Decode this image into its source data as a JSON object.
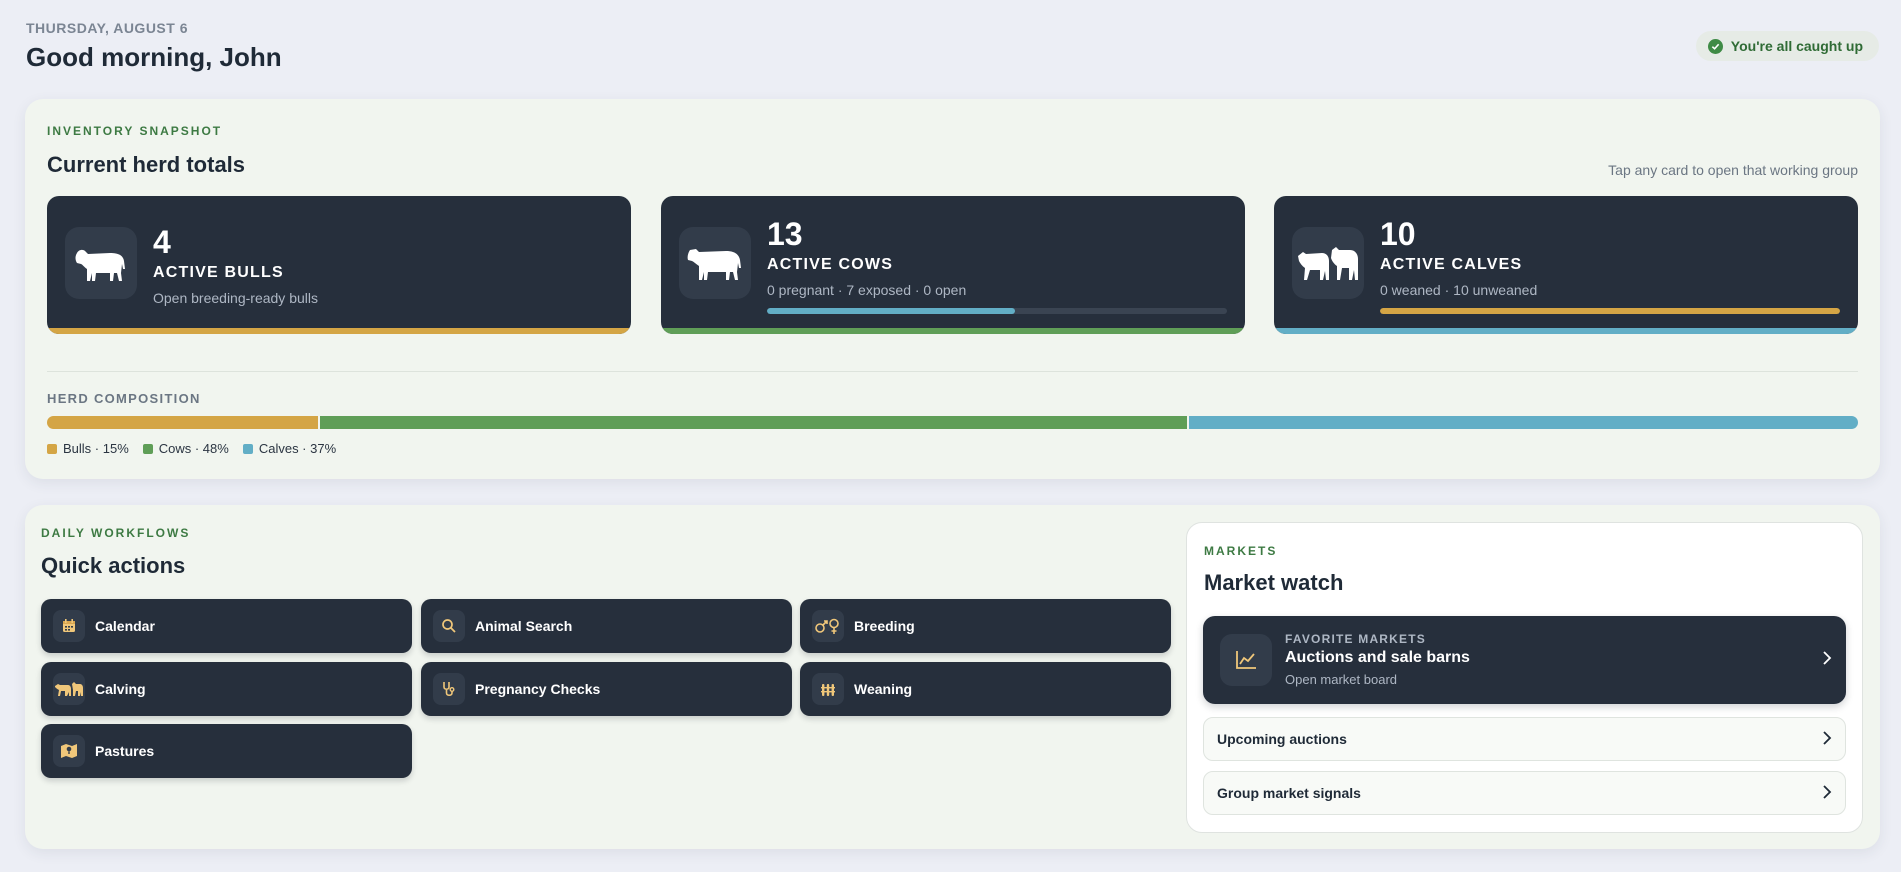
{
  "header": {
    "date": "THURSDAY, AUGUST 6",
    "greeting": "Good morning, John",
    "status_badge": "You're all caught up"
  },
  "inventory": {
    "eyebrow": "INVENTORY SNAPSHOT",
    "title": "Current herd totals",
    "hint": "Tap any card to open that working group",
    "cards": [
      {
        "count": "4",
        "label": "ACTIVE BULLS",
        "sub": "Open breeding-ready bulls",
        "icon": "bull-icon",
        "accent": "#d4a545"
      },
      {
        "count": "13",
        "label": "ACTIVE COWS",
        "sub": "0 pregnant · 7 exposed · 0 open",
        "icon": "cow-icon",
        "accent": "#5f9e57",
        "progress": 0.54,
        "progress_color": "#62aec6"
      },
      {
        "count": "10",
        "label": "ACTIVE CALVES",
        "sub": "0 weaned · 10 unweaned",
        "icon": "calves-icon",
        "accent": "#62aec6",
        "progress": 1.0,
        "progress_color": "#d4a545"
      }
    ],
    "composition": {
      "label": "HERD COMPOSITION",
      "segments": [
        {
          "name": "Bulls",
          "percent": 15,
          "legend": "Bulls · 15%",
          "color": "#d4a545"
        },
        {
          "name": "Cows",
          "percent": 48,
          "legend": "Cows · 48%",
          "color": "#5f9e57"
        },
        {
          "name": "Calves",
          "percent": 37,
          "legend": "Calves · 37%",
          "color": "#62aec6"
        }
      ]
    }
  },
  "workflows": {
    "eyebrow": "DAILY WORKFLOWS",
    "title": "Quick actions",
    "actions": [
      {
        "label": "Calendar",
        "icon": "calendar-icon"
      },
      {
        "label": "Animal Search",
        "icon": "search-icon"
      },
      {
        "label": "Breeding",
        "icon": "breeding-icon"
      },
      {
        "label": "Calving",
        "icon": "calving-icon"
      },
      {
        "label": "Pregnancy Checks",
        "icon": "stethoscope-icon"
      },
      {
        "label": "Weaning",
        "icon": "weaning-icon"
      },
      {
        "label": "Pastures",
        "icon": "pasture-map-icon"
      }
    ]
  },
  "markets": {
    "eyebrow": "MARKETS",
    "title": "Market watch",
    "favorite": {
      "eyebrow": "FAVORITE MARKETS",
      "title": "Auctions and sale barns",
      "sub": "Open market board"
    },
    "rows": [
      "Upcoming auctions",
      "Group market signals"
    ]
  },
  "colors": {
    "card_dark": "#262f3c",
    "brand_green": "#3d7a43",
    "gold": "#d4a545",
    "green": "#5f9e57",
    "blue": "#62aec6"
  }
}
